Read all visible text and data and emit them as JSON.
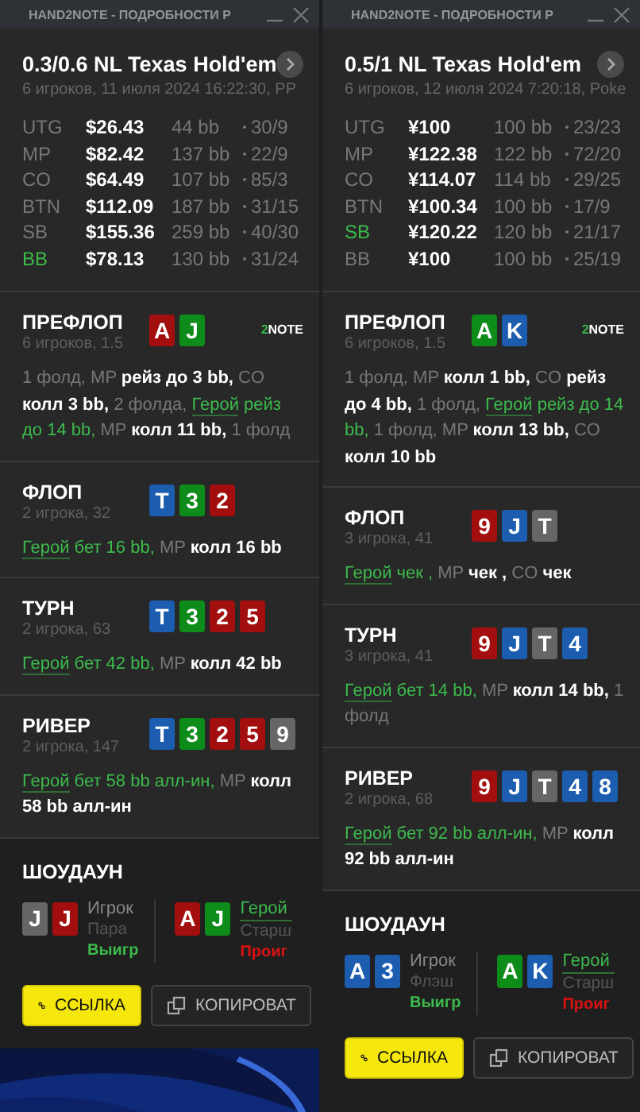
{
  "panels": [
    {
      "title": "HAND2NOTE - ПОДРОБНОСТИ Р",
      "game": "0.3/0.6 NL Texas Hold'em",
      "info": "6 игроков, 11 июля 2024 16:22:30, PP",
      "players": [
        {
          "pos": "UTG",
          "stack": "$26.43",
          "bb": "44 bb",
          "stats": "30/9",
          "hero": false
        },
        {
          "pos": "MP",
          "stack": "$82.42",
          "bb": "137 bb",
          "stats": "22/9",
          "hero": false
        },
        {
          "pos": "CO",
          "stack": "$64.49",
          "bb": "107 bb",
          "stats": "85/3",
          "hero": false
        },
        {
          "pos": "BTN",
          "stack": "$112.09",
          "bb": "187 bb",
          "stats": "31/15",
          "hero": false
        },
        {
          "pos": "SB",
          "stack": "$155.36",
          "bb": "259 bb",
          "stats": "40/30",
          "hero": false
        },
        {
          "pos": "BB",
          "stack": "$78.13",
          "bb": "130 bb",
          "stats": "31/24",
          "hero": true
        }
      ],
      "streets": [
        {
          "name": "ПРЕФЛОП",
          "info": "6 игроков, 1.5",
          "logo": {
            "mark": "2",
            "text": "NOTE"
          },
          "cards": [
            {
              "rank": "A",
              "color": "#a30e0e"
            },
            {
              "rank": "J",
              "color": "#0e8c1a"
            }
          ],
          "actions": [
            {
              "t": "1 фолд, MP ",
              "kind": "muted"
            },
            {
              "t": "рейз до 3 bb,",
              "kind": "action"
            },
            {
              "t": " CO ",
              "kind": "muted"
            },
            {
              "t": "колл 3 bb,",
              "kind": "action"
            },
            {
              "t": " 2 фолда, ",
              "kind": "muted"
            },
            {
              "t": "Герой",
              "kind": "hero-link"
            },
            {
              "t": " рейз до 14 bb,",
              "kind": "hero"
            },
            {
              "t": " MP ",
              "kind": "muted"
            },
            {
              "t": "колл 11 bb,",
              "kind": "action"
            },
            {
              "t": " 1 фолд",
              "kind": "muted"
            }
          ]
        },
        {
          "name": "ФЛОП",
          "info": "2 игрока, 32",
          "cards": [
            {
              "rank": "T",
              "color": "#1c5db0"
            },
            {
              "rank": "3",
              "color": "#0e8c1a"
            },
            {
              "rank": "2",
              "color": "#a30e0e"
            }
          ],
          "actions": [
            {
              "t": "Герой",
              "kind": "hero-link"
            },
            {
              "t": " бет 16 bb,",
              "kind": "hero"
            },
            {
              "t": " MP ",
              "kind": "muted"
            },
            {
              "t": "колл 16 bb",
              "kind": "action"
            }
          ]
        },
        {
          "name": "ТУРН",
          "info": "2 игрока, 63",
          "cards": [
            {
              "rank": "T",
              "color": "#1c5db0"
            },
            {
              "rank": "3",
              "color": "#0e8c1a"
            },
            {
              "rank": "2",
              "color": "#a30e0e"
            },
            {
              "rank": "5",
              "color": "#a30e0e"
            }
          ],
          "actions": [
            {
              "t": "Герой",
              "kind": "hero-link"
            },
            {
              "t": " бет 42 bb,",
              "kind": "hero"
            },
            {
              "t": " MP ",
              "kind": "muted"
            },
            {
              "t": "колл 42 bb",
              "kind": "action"
            }
          ]
        },
        {
          "name": "РИВЕР",
          "info": "2 игрока, 147",
          "cards": [
            {
              "rank": "T",
              "color": "#1c5db0"
            },
            {
              "rank": "3",
              "color": "#0e8c1a"
            },
            {
              "rank": "2",
              "color": "#a30e0e"
            },
            {
              "rank": "5",
              "color": "#a30e0e"
            },
            {
              "rank": "9",
              "color": "#666666"
            }
          ],
          "actions": [
            {
              "t": "Герой",
              "kind": "hero-link"
            },
            {
              "t": " бет 58 bb алл-ин,",
              "kind": "hero"
            },
            {
              "t": " MP ",
              "kind": "muted"
            },
            {
              "t": "колл 58 bb алл-ин",
              "kind": "action"
            }
          ]
        }
      ],
      "showdown": {
        "title": "ШОУДАУН",
        "hands": [
          {
            "cards": [
              {
                "rank": "J",
                "color": "#666666"
              },
              {
                "rank": "J",
                "color": "#a30e0e"
              }
            ],
            "name": "Игрок",
            "hand": "Пара",
            "result": "Выигр",
            "won": true,
            "hero": false
          },
          {
            "cards": [
              {
                "rank": "A",
                "color": "#a30e0e"
              },
              {
                "rank": "J",
                "color": "#0e8c1a"
              }
            ],
            "name": "Герой",
            "hand": "Старш",
            "result": "Проиг",
            "won": false,
            "hero": true
          }
        ]
      },
      "buttons": [
        {
          "label": "ССЫЛКА",
          "kind": "link"
        },
        {
          "label": "КОПИРОВАТ",
          "kind": "copy"
        }
      ]
    },
    {
      "title": "HAND2NOTE - ПОДРОБНОСТИ Р",
      "game": "0.5/1 NL Texas Hold'em",
      "info": "6 игроков, 12 июля 2024 7:20:18, Poke",
      "players": [
        {
          "pos": "UTG",
          "stack": "¥100",
          "bb": "100 bb",
          "stats": "23/23",
          "hero": false
        },
        {
          "pos": "MP",
          "stack": "¥122.38",
          "bb": "122 bb",
          "stats": "72/20",
          "hero": false
        },
        {
          "pos": "CO",
          "stack": "¥114.07",
          "bb": "114 bb",
          "stats": "29/25",
          "hero": false
        },
        {
          "pos": "BTN",
          "stack": "¥100.34",
          "bb": "100 bb",
          "stats": "17/9",
          "hero": false
        },
        {
          "pos": "SB",
          "stack": "¥120.22",
          "bb": "120 bb",
          "stats": "21/17",
          "hero": true
        },
        {
          "pos": "BB",
          "stack": "¥100",
          "bb": "100 bb",
          "stats": "25/19",
          "hero": false
        }
      ],
      "streets": [
        {
          "name": "ПРЕФЛОП",
          "info": "6 игроков, 1.5",
          "logo": {
            "mark": "2",
            "text": "NOTE"
          },
          "cards": [
            {
              "rank": "A",
              "color": "#0e8c1a"
            },
            {
              "rank": "K",
              "color": "#1c5db0"
            }
          ],
          "actions": [
            {
              "t": "1 фолд, MP ",
              "kind": "muted"
            },
            {
              "t": "колл 1 bb,",
              "kind": "action"
            },
            {
              "t": " CO ",
              "kind": "muted"
            },
            {
              "t": "рейз до 4 bb,",
              "kind": "action"
            },
            {
              "t": " 1 фолд, ",
              "kind": "muted"
            },
            {
              "t": "Герой",
              "kind": "hero-link"
            },
            {
              "t": " рейз до 14 bb,",
              "kind": "hero"
            },
            {
              "t": " 1 фолд, MP ",
              "kind": "muted"
            },
            {
              "t": "колл 13 bb,",
              "kind": "action"
            },
            {
              "t": " CO ",
              "kind": "muted"
            },
            {
              "t": "колл 10 bb",
              "kind": "action"
            }
          ]
        },
        {
          "name": "ФЛОП",
          "info": "3 игрока, 41",
          "cards": [
            {
              "rank": "9",
              "color": "#a30e0e"
            },
            {
              "rank": "J",
              "color": "#1c5db0"
            },
            {
              "rank": "T",
              "color": "#666666"
            }
          ],
          "actions": [
            {
              "t": "Герой",
              "kind": "hero-link"
            },
            {
              "t": " чек ,",
              "kind": "hero"
            },
            {
              "t": " MP ",
              "kind": "muted"
            },
            {
              "t": "чек ,",
              "kind": "action"
            },
            {
              "t": " CO ",
              "kind": "muted"
            },
            {
              "t": "чек",
              "kind": "action"
            }
          ]
        },
        {
          "name": "ТУРН",
          "info": "3 игрока, 41",
          "cards": [
            {
              "rank": "9",
              "color": "#a30e0e"
            },
            {
              "rank": "J",
              "color": "#1c5db0"
            },
            {
              "rank": "T",
              "color": "#666666"
            },
            {
              "rank": "4",
              "color": "#1c5db0"
            }
          ],
          "actions": [
            {
              "t": "Герой",
              "kind": "hero-link"
            },
            {
              "t": " бет 14 bb,",
              "kind": "hero"
            },
            {
              "t": " MP ",
              "kind": "muted"
            },
            {
              "t": "колл 14 bb,",
              "kind": "action"
            },
            {
              "t": " 1 фолд",
              "kind": "muted"
            }
          ]
        },
        {
          "name": "РИВЕР",
          "info": "2 игрока, 68",
          "cards": [
            {
              "rank": "9",
              "color": "#a30e0e"
            },
            {
              "rank": "J",
              "color": "#1c5db0"
            },
            {
              "rank": "T",
              "color": "#666666"
            },
            {
              "rank": "4",
              "color": "#1c5db0"
            },
            {
              "rank": "8",
              "color": "#1c5db0"
            }
          ],
          "actions": [
            {
              "t": "Герой",
              "kind": "hero-link"
            },
            {
              "t": " бет 92 bb алл-ин,",
              "kind": "hero"
            },
            {
              "t": " MP ",
              "kind": "muted"
            },
            {
              "t": "колл 92 bb алл-ин",
              "kind": "action"
            }
          ]
        }
      ],
      "showdown": {
        "title": "ШОУДАУН",
        "hands": [
          {
            "cards": [
              {
                "rank": "A",
                "color": "#1c5db0"
              },
              {
                "rank": "3",
                "color": "#1c5db0"
              }
            ],
            "name": "Игрок",
            "hand": "Флэш",
            "result": "Выигр",
            "won": true,
            "hero": false
          },
          {
            "cards": [
              {
                "rank": "A",
                "color": "#0e8c1a"
              },
              {
                "rank": "K",
                "color": "#1c5db0"
              }
            ],
            "name": "Герой",
            "hand": "Старш",
            "result": "Проиг",
            "won": false,
            "hero": true
          }
        ]
      },
      "buttons": [
        {
          "label": "ССЫЛКА",
          "kind": "link"
        },
        {
          "label": "КОПИРОВАТ",
          "kind": "copy"
        }
      ]
    }
  ]
}
